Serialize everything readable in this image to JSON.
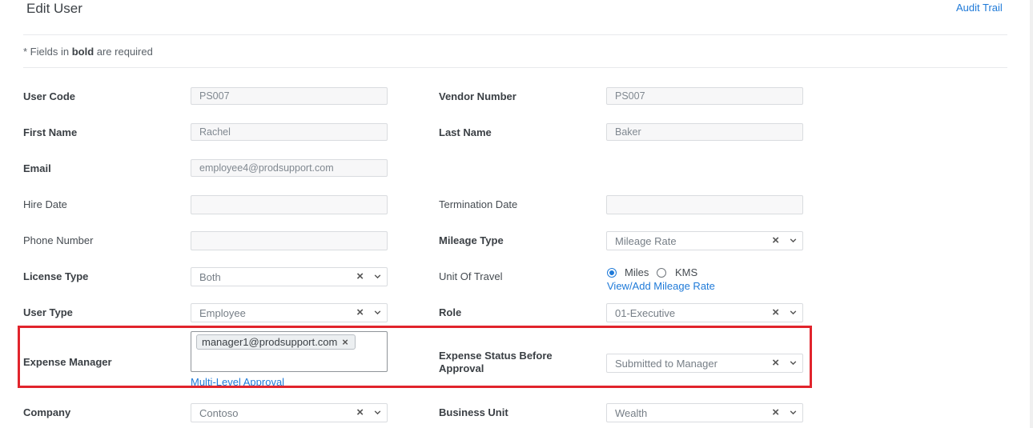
{
  "header": {
    "title": "Edit User",
    "audit_trail": "Audit Trail"
  },
  "note": {
    "prefix": "* Fields in ",
    "bold": "bold",
    "suffix": " are required"
  },
  "fields": {
    "user_code": {
      "label": "User Code",
      "value": "PS007"
    },
    "vendor_number": {
      "label": "Vendor Number",
      "value": "PS007"
    },
    "first_name": {
      "label": "First Name",
      "value": "Rachel"
    },
    "last_name": {
      "label": "Last Name",
      "value": "Baker"
    },
    "email": {
      "label": "Email",
      "value": "employee4@prodsupport.com"
    },
    "hire_date": {
      "label": "Hire Date",
      "value": ""
    },
    "termination_date": {
      "label": "Termination Date",
      "value": ""
    },
    "phone_number": {
      "label": "Phone Number",
      "value": ""
    },
    "mileage_type": {
      "label": "Mileage Type",
      "value": "Mileage Rate"
    },
    "license_type": {
      "label": "License Type",
      "value": "Both"
    },
    "unit_of_travel": {
      "label": "Unit Of Travel",
      "options": [
        "Miles",
        "KMS"
      ],
      "selected": "Miles",
      "link": "View/Add Mileage Rate"
    },
    "user_type": {
      "label": "User Type",
      "value": "Employee"
    },
    "role": {
      "label": "Role",
      "value": "01-Executive"
    },
    "expense_manager": {
      "label": "Expense Manager",
      "chip": "manager1@prodsupport.com",
      "link": "Multi-Level Approval"
    },
    "expense_status": {
      "label_line1": "Expense Status Before",
      "label_line2": "Approval",
      "value": "Submitted to Manager"
    },
    "company": {
      "label": "Company",
      "value": "Contoso"
    },
    "business_unit": {
      "label": "Business Unit",
      "value": "Wealth"
    }
  },
  "icons": {
    "clear": "×",
    "chevron": "chevron-down-icon",
    "chip_remove": "×"
  },
  "colors": {
    "link": "#1f7ad8",
    "highlight": "#e1242c"
  }
}
